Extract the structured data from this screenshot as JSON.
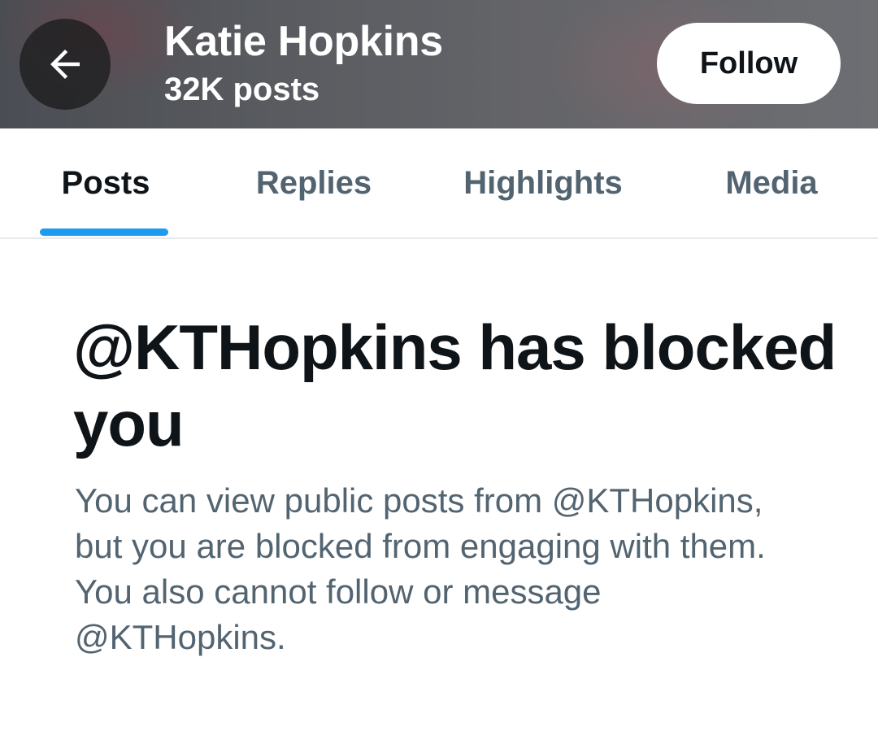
{
  "header": {
    "back_icon": "arrow-left-icon",
    "profile_name": "Katie Hopkins",
    "post_count": "32K posts",
    "follow_label": "Follow"
  },
  "tabs": [
    {
      "label": "Posts",
      "active": true
    },
    {
      "label": "Replies",
      "active": false
    },
    {
      "label": "Highlights",
      "active": false
    },
    {
      "label": "Media",
      "active": false
    }
  ],
  "blocked": {
    "title": "@KTHopkins has blocked you",
    "description": "You can view public posts from @KTHopkins, but you are blocked from engaging with them. You also cannot follow or message @KTHopkins."
  },
  "colors": {
    "accent": "#1d9bf0",
    "primary_text": "#0f1419",
    "secondary_text": "#536471"
  }
}
